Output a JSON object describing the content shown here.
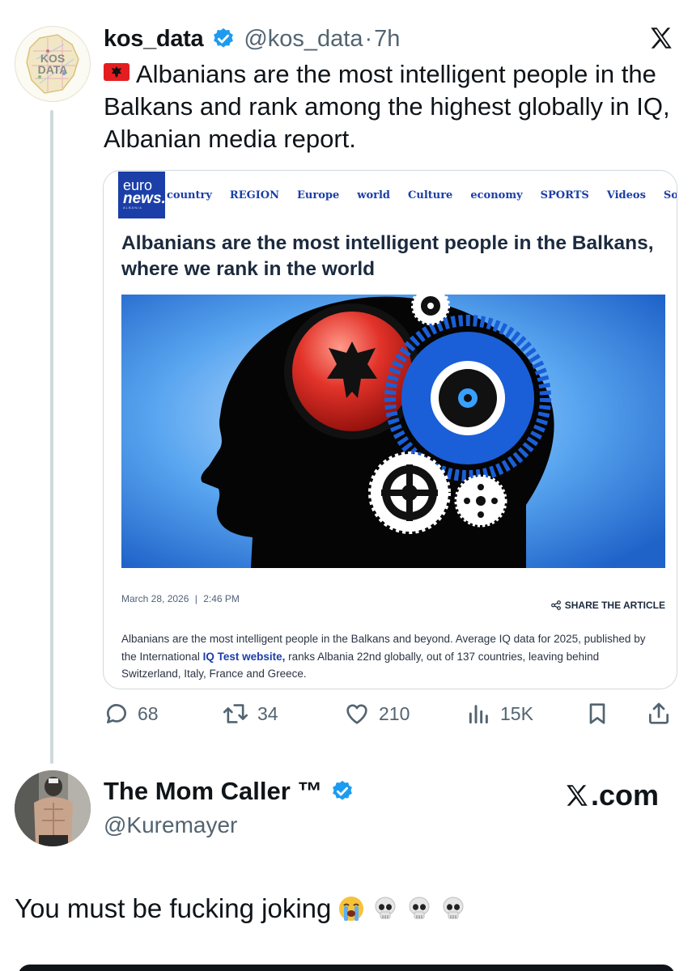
{
  "tweet": {
    "avatar_text": [
      "KOS",
      "DATA"
    ],
    "name": "kos_data",
    "handle": "@kos_data",
    "separator": "·",
    "time": "7h",
    "text": "Albanians are the most intelligent people in the Balkans and rank among the highest globally in IQ, Albanian media report.",
    "card": {
      "logo": {
        "line1": "euro",
        "line2": "news.",
        "line3": "ALBANIA"
      },
      "nav": [
        "country",
        "REGION",
        "Europe",
        "world",
        "Culture",
        "economy",
        "SPORTS",
        "Videos",
        "Softwa"
      ],
      "title": "Albanians are the most intelligent people in the Balkans, where we rank in the world",
      "date": "March 28, 2026",
      "date_sep": "|",
      "time": "2:46 PM",
      "share": "SHARE THE ARTICLE",
      "body_1": "Albanians are the most intelligent people in the Balkans and beyond. Average IQ data for 2025, published by the International ",
      "body_link": "IQ Test website,",
      "body_2": " ranks Albania 22nd globally, out of 137 countries, leaving behind Switzerland, Italy, France and Greece."
    },
    "actions": {
      "replies": "68",
      "reposts": "34",
      "likes": "210",
      "views": "15K"
    }
  },
  "reply": {
    "name": "The Mom Caller ™",
    "handle": "@Kuremayer",
    "watermark": ".com",
    "text": "You must be fucking joking"
  },
  "colors": {
    "verified": "#1d9bf0",
    "secondary_text": "#536471",
    "euronews_blue": "#1b3ea8",
    "flag_red": "#e41e20"
  },
  "icons": [
    "verified-badge-icon",
    "x-logo-icon",
    "albania-flag-icon",
    "reply-icon",
    "repost-icon",
    "like-icon",
    "views-icon",
    "bookmark-icon",
    "share-icon",
    "loudly-crying-face-emoji",
    "skull-emoji"
  ]
}
